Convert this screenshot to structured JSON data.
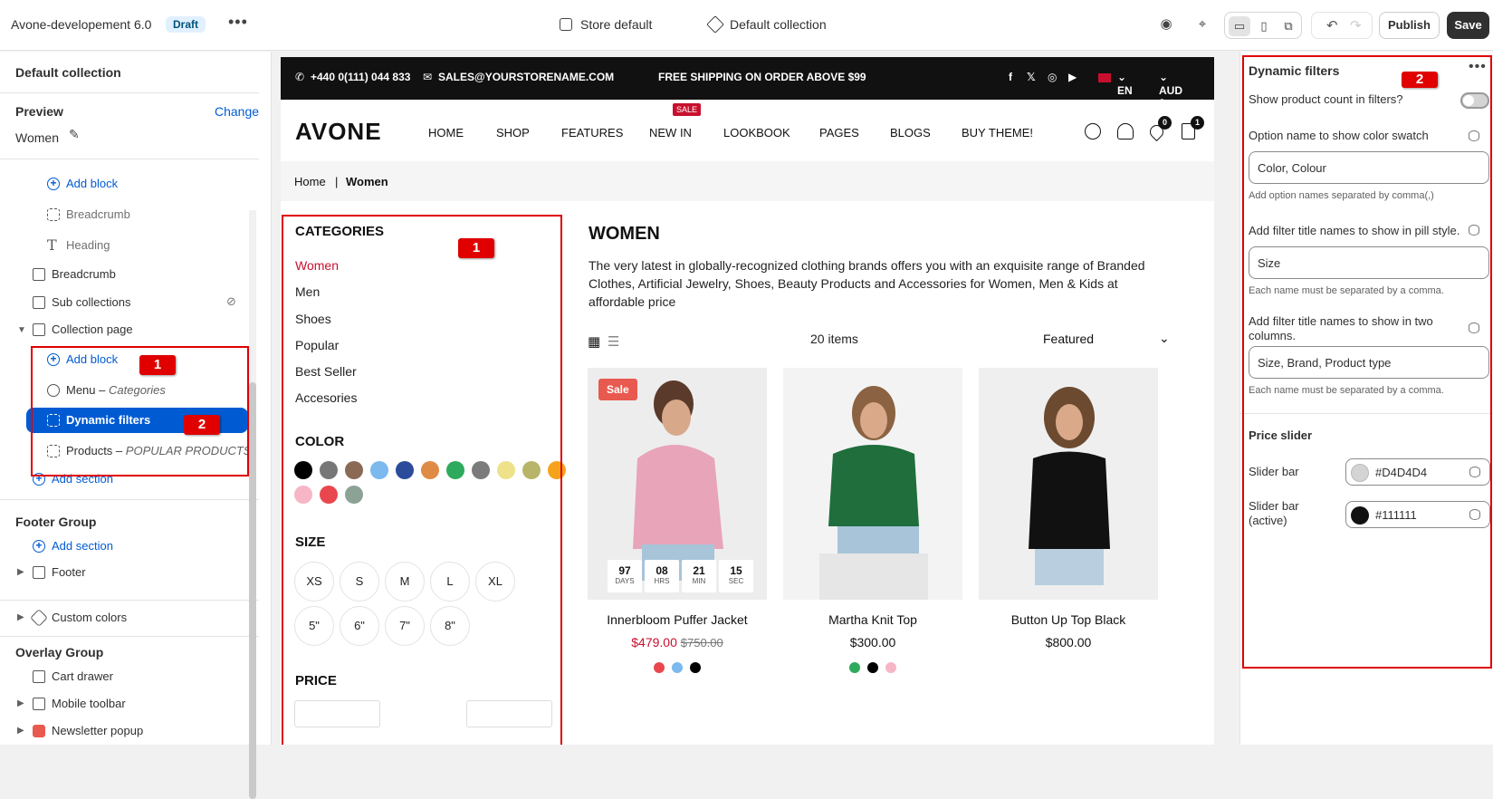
{
  "topbar": {
    "theme_name": "Avone-developement 6.0",
    "status": "Draft",
    "store": "Store default",
    "template": "Default collection",
    "publish": "Publish",
    "save": "Save"
  },
  "left": {
    "title": "Default collection",
    "preview_label": "Preview",
    "change": "Change",
    "preview_value": "Women",
    "items": [
      {
        "label": "Add block"
      },
      {
        "label": "Breadcrumb"
      },
      {
        "label": "Heading"
      },
      {
        "label": "Breadcrumb"
      },
      {
        "label": "Sub collections"
      },
      {
        "label": "Collection page"
      },
      {
        "label": "Add block"
      },
      {
        "label": "Menu",
        "sub": "Categories"
      },
      {
        "label": "Dynamic filters"
      },
      {
        "label": "Products",
        "sub": "POPULAR PRODUCTS"
      },
      {
        "label": "Add section"
      }
    ],
    "footer_group": "Footer Group",
    "footer_add": "Add section",
    "footer": "Footer",
    "custom_colors": "Custom colors",
    "overlay_group": "Overlay Group",
    "cart_drawer": "Cart drawer",
    "mobile_toolbar": "Mobile toolbar",
    "newsletter": "Newsletter popup"
  },
  "annot": {
    "one": "1",
    "two": "2"
  },
  "store": {
    "phone": "+440 0(111) 044 833",
    "email": "SALES@YOURSTORENAME.COM",
    "shipping": "FREE SHIPPING ON ORDER ABOVE $99",
    "lang": "EN",
    "currency": "AUD $",
    "logo": "AVONE",
    "nav": [
      "HOME",
      "SHOP",
      "FEATURES",
      "NEW IN",
      "LOOKBOOK",
      "PAGES",
      "BLOGS",
      "BUY THEME!"
    ],
    "sale_tag": "SALE",
    "wishlist_count": "0",
    "cart_count": "1",
    "crumb_home": "Home",
    "crumb_sep": "|",
    "crumb_current": "Women",
    "categories_title": "CATEGORIES",
    "categories": [
      "Women",
      "Men",
      "Shoes",
      "Popular",
      "Best Seller",
      "Accesories"
    ],
    "color_title": "COLOR",
    "size_title": "SIZE",
    "sizes": [
      "XS",
      "S",
      "M",
      "L",
      "XL",
      "5\"",
      "6\"",
      "7\"",
      "8\""
    ],
    "price_title": "PRICE",
    "heading": "WOMEN",
    "description": "The very latest in globally-recognized clothing brands offers you with an exquisite range of Branded Clothes, Artificial Jewelry, Shoes, Beauty Products and Accessories for Women, Men & Kids at affordable price",
    "items_count": "20 items",
    "sort": "Featured",
    "products": [
      {
        "name": "Innerbloom Puffer Jacket",
        "price": "$479.00",
        "compare": "$750.00",
        "badge": "Sale"
      },
      {
        "name": "Martha Knit Top",
        "price": "$300.00"
      },
      {
        "name": "Button Up Top Black",
        "price": "$800.00"
      }
    ],
    "timer": [
      {
        "v": "97",
        "u": "DAYS"
      },
      {
        "v": "08",
        "u": "HRS"
      },
      {
        "v": "21",
        "u": "MIN"
      },
      {
        "v": "15",
        "u": "SEC"
      }
    ]
  },
  "right": {
    "title": "Dynamic filters",
    "show_count": "Show product count in filters?",
    "swatch_label": "Option name to show color swatch",
    "swatch_value": "Color, Colour",
    "swatch_hint": "Add option names separated by comma(,)",
    "pill_label": "Add filter title names to show in pill style.",
    "pill_value": "Size",
    "pill_hint": "Each name must be separated by a comma.",
    "two_label": "Add filter title names to show in two columns.",
    "two_value": "Size, Brand, Product type",
    "two_hint": "Each name must be separated by a comma.",
    "price_slider": "Price slider",
    "slider_bar": "Slider bar",
    "slider_bar_value": "#D4D4D4",
    "slider_active": "Slider bar (active)",
    "slider_active_value": "#111111"
  },
  "colors": {
    "accent": "#005bd3",
    "sale": "#c8102e",
    "annot": "#e00000"
  }
}
